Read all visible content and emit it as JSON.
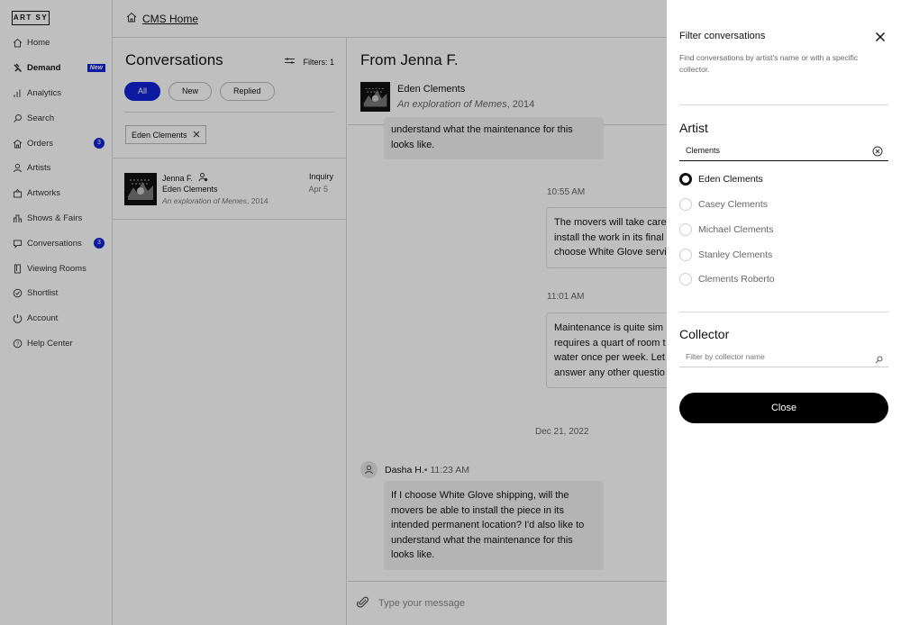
{
  "sidebar": {
    "logo": "ART SY",
    "items": [
      {
        "label": "Home",
        "icon": "home-icon"
      },
      {
        "label": "Demand",
        "icon": "demand-icon",
        "tag": "New",
        "active": true
      },
      {
        "label": "Analytics",
        "icon": "analytics-icon"
      },
      {
        "label": "Search",
        "icon": "search-icon"
      },
      {
        "label": "Orders",
        "icon": "orders-icon",
        "badge": "3"
      },
      {
        "label": "Artists",
        "icon": "artists-icon"
      },
      {
        "label": "Artworks",
        "icon": "artworks-icon"
      },
      {
        "label": "Shows & Fairs",
        "icon": "shows-icon"
      },
      {
        "label": "Conversations",
        "icon": "conversations-icon",
        "badge": "3"
      },
      {
        "label": "Viewing Rooms",
        "icon": "viewing-rooms-icon"
      },
      {
        "label": "Shortlist",
        "icon": "shortlist-icon"
      },
      {
        "label": "Account",
        "icon": "account-icon"
      },
      {
        "label": "Help Center",
        "icon": "help-icon"
      }
    ]
  },
  "topbar": {
    "home_label": "CMS Home"
  },
  "conversations": {
    "title": "Conversations",
    "filters_label": "Filters: 1",
    "pills": {
      "all": "All",
      "new": "New",
      "replied": "Replied"
    },
    "active_filter_chip": "Eden Clements",
    "items": [
      {
        "name": "Jenna F.",
        "artist": "Eden Clements",
        "work_title": "An exploration of Memes",
        "work_year": ", 2014",
        "type": "Inquiry",
        "date": "Apr 5"
      }
    ]
  },
  "chat": {
    "title": "From Jenna F.",
    "artist": "Eden Clements",
    "work_title": "An exploration of Memes",
    "work_year": ", 2014",
    "top_bubble": {
      "line1": "understand what the maintenance for this",
      "line2": "looks like."
    },
    "time1": "10:55 AM",
    "reply1": {
      "line1": "The movers will take care",
      "line2": "install the work in its final",
      "line3": "choose White Glove servi"
    },
    "time2": "11:01 AM",
    "reply2": {
      "line1": "Maintenance is quite sim",
      "line2": "requires a quart of room t",
      "line3": "water once per week. Let",
      "line4": "answer any other questio"
    },
    "date_sep": "Dec 21, 2022",
    "sender_name": "Dasha H.",
    "sender_time": " • 11:23 AM",
    "message": {
      "line1": "If I choose White Glove shipping, will the",
      "line2": "movers be able to install the piece in its",
      "line3": "intended permanent location? I'd also like to",
      "line4": "understand what the maintenance for this",
      "line5": "looks like."
    },
    "composer_placeholder": "Type your message"
  },
  "filter_panel": {
    "title": "Filter conversations",
    "description": "Find conversations by artist's name or with a specific collector.",
    "artist_section": "Artist",
    "artist_query": "Clements",
    "artist_options": [
      {
        "label": "Eden Clements",
        "checked": true
      },
      {
        "label": "Casey Clements",
        "checked": false
      },
      {
        "label": "Michael Clements",
        "checked": false
      },
      {
        "label": "Stanley Clements",
        "checked": false
      },
      {
        "label": "Clements Roberto",
        "checked": false
      }
    ],
    "collector_section": "Collector",
    "collector_placeholder": "Filter by collector name",
    "close_label": "Close"
  },
  "colors": {
    "accent": "#1023d7",
    "overlay": "rgba(0,0,0,0.25)",
    "primary_button": "#000000"
  }
}
